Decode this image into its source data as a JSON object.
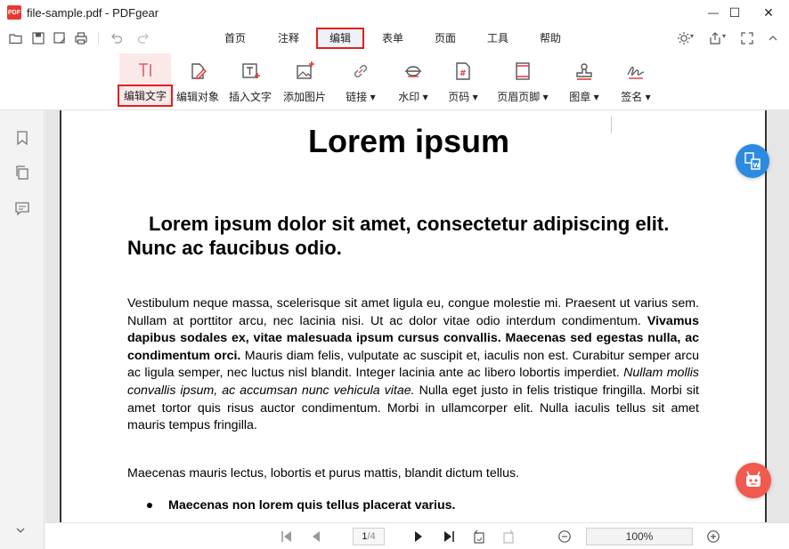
{
  "window": {
    "title": "file-sample.pdf - PDFgear",
    "logo_text": "PDF",
    "controls": {
      "minimize": "—",
      "maximize": "☐",
      "close": "✕"
    }
  },
  "quick_access": [
    "open-icon",
    "save-icon",
    "save-as-icon",
    "print-icon",
    "undo-icon",
    "redo-icon"
  ],
  "menu": {
    "items": [
      {
        "label": "首页"
      },
      {
        "label": "注释"
      },
      {
        "label": "编辑",
        "active": true
      },
      {
        "label": "表单"
      },
      {
        "label": "页面"
      },
      {
        "label": "工具"
      },
      {
        "label": "帮助"
      }
    ]
  },
  "toolbar": {
    "tools": [
      {
        "label": "编辑文字",
        "icon": "edit-text-icon",
        "selected": true
      },
      {
        "label": "编辑对象",
        "icon": "edit-object-icon"
      },
      {
        "label": "插入文字",
        "icon": "insert-text-icon"
      },
      {
        "label": "添加图片",
        "icon": "add-image-icon"
      },
      {
        "label": "链接",
        "icon": "link-icon",
        "dropdown": true
      },
      {
        "label": "水印",
        "icon": "watermark-icon",
        "dropdown": true
      },
      {
        "label": "页码",
        "icon": "page-number-icon",
        "dropdown": true
      },
      {
        "label": "页眉页脚",
        "icon": "header-footer-icon",
        "dropdown": true
      },
      {
        "label": "图章",
        "icon": "stamp-icon",
        "dropdown": true
      },
      {
        "label": "签名",
        "icon": "signature-icon",
        "dropdown": true
      }
    ],
    "dropdown_arrow": "▾"
  },
  "document": {
    "title": "Lorem ipsum",
    "subtitle": "Lorem ipsum dolor sit amet, consectetur adipiscing elit. Nunc ac faucibus odio.",
    "para1_a": "Vestibulum neque massa, scelerisque sit amet ligula eu, congue molestie mi. Praesent ut varius sem. Nullam at porttitor arcu, nec lacinia nisi. Ut ac dolor vitae odio interdum condimentum. ",
    "para1_b": "Vivamus dapibus sodales ex, vitae malesuada ipsum cursus convallis. Maecenas sed egestas nulla, ac condimentum orci.",
    "para1_c": " Mauris diam felis, vulputate ac suscipit et, iaculis non est. Curabitur semper arcu ac ligula semper, nec luctus nisl blandit. Integer lacinia ante ac libero lobortis imperdiet. ",
    "para1_d": "Nullam mollis convallis ipsum, ac accumsan nunc vehicula vitae.",
    "para1_e": " Nulla eget justo in felis tristique fringilla. Morbi sit amet tortor quis risus auctor condimentum. Morbi in ullamcorper elit. Nulla iaculis tellus sit amet mauris tempus fringilla.",
    "para2": "Maecenas mauris lectus, lobortis et purus mattis, blandit dictum tellus.",
    "bullet1": "Maecenas non lorem quis tellus placerat varius."
  },
  "status": {
    "current_page": "1",
    "total_pages": "/4",
    "zoom": "100%"
  },
  "colors": {
    "accent_red": "#e02020",
    "convert_button": "#2b8be0",
    "assistant_button": "#f05a4f"
  }
}
